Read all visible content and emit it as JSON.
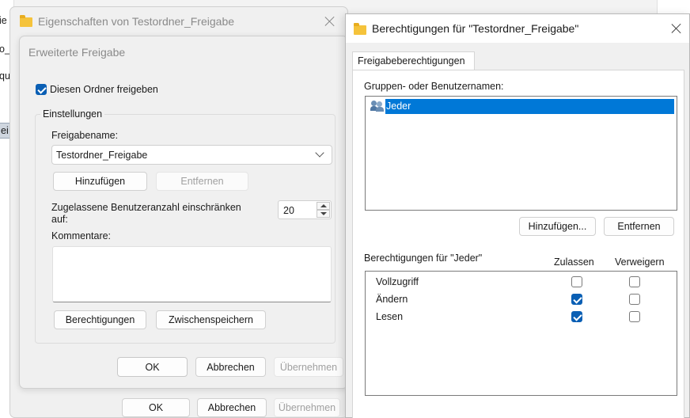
{
  "background_window": {
    "side_fragments": [
      "ie",
      "o_",
      "qu",
      "ei"
    ],
    "buttons": {
      "ok": "OK",
      "cancel": "Abbrechen",
      "apply": "Übernehmen"
    }
  },
  "properties_dialog": {
    "title": "Eigenschaften von Testordner_Freigabe",
    "buttons": {
      "ok": "OK",
      "cancel": "Abbrechen",
      "apply": "Übernehmen"
    }
  },
  "advanced_sharing": {
    "title": "Erweiterte Freigabe",
    "share_checkbox_label": "Diesen Ordner freigeben",
    "share_checked": true,
    "settings_group_label": "Einstellungen",
    "share_name_label": "Freigabename:",
    "share_name_value": "Testordner_Freigabe",
    "add_button": "Hinzufügen",
    "remove_button": "Entfernen",
    "user_limit_label_line1": "Zugelassene Benutzeranzahl einschränken",
    "user_limit_label_line2": "auf:",
    "user_limit_value": "20",
    "comments_label": "Kommentare:",
    "comments_value": "",
    "permissions_button": "Berechtigungen",
    "caching_button": "Zwischenspeichern"
  },
  "permissions_dialog": {
    "title": "Berechtigungen für \"Testordner_Freigabe\"",
    "tab_label": "Freigabeberechtigungen",
    "groups_label": "Gruppen- oder Benutzernamen:",
    "groups": [
      {
        "name": "Jeder",
        "selected": true
      }
    ],
    "add_button": "Hinzufügen...",
    "remove_button": "Entfernen",
    "permissions_label": "Berechtigungen für \"Jeder\"",
    "allow_header": "Zulassen",
    "deny_header": "Verweigern",
    "permissions": [
      {
        "name": "Vollzugriff",
        "allow": false,
        "deny": false
      },
      {
        "name": "Ändern",
        "allow": true,
        "deny": false
      },
      {
        "name": "Lesen",
        "allow": true,
        "deny": false
      }
    ]
  },
  "colors": {
    "accent": "#0a5fb4",
    "selection": "#0078d7",
    "folder": "#f5c33b"
  }
}
